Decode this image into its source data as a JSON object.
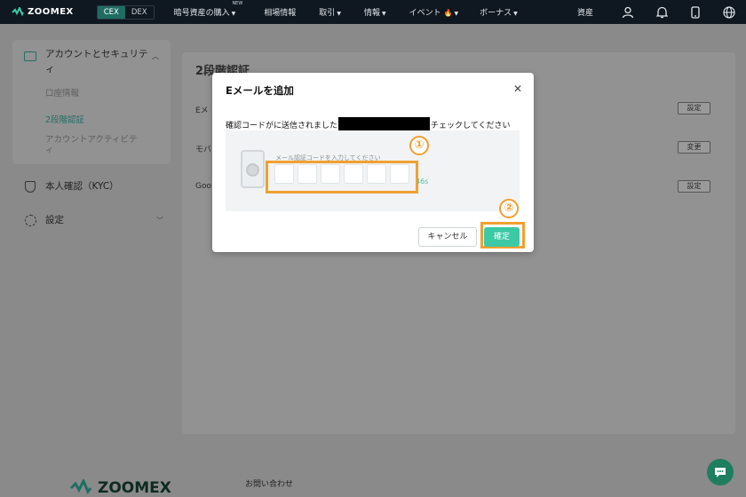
{
  "nav": {
    "logo_text": "ZOOMEX",
    "cex": "CEX",
    "dex": "DEX",
    "items": [
      {
        "label": "暗号資産の購入",
        "tag": "NEW"
      },
      {
        "label": "相場情報"
      },
      {
        "label": "取引"
      },
      {
        "label": "情報"
      },
      {
        "label": "イベント"
      },
      {
        "label": "ボーナス"
      }
    ],
    "assets": "資産",
    "icons": [
      "user-icon",
      "bell-icon",
      "phone-icon",
      "globe-icon"
    ]
  },
  "sidebar": {
    "account_security": "アカウントとセキュリティ",
    "account_info": "口座情報",
    "two_factor": "2段階認証",
    "account_activity": "アカウントアクティビティ",
    "kyc": "本人確認（KYC）",
    "settings": "設定"
  },
  "content": {
    "title": "2段階認証",
    "rows": [
      {
        "label": "Eメ",
        "button": "設定"
      },
      {
        "label": "モバ",
        "button": "変更"
      },
      {
        "label": "Goo",
        "button": "設定"
      }
    ]
  },
  "modal": {
    "title": "Eメールを追加",
    "sent_prefix": "確認コードがに送信されました",
    "sent_suffix": "チェックしてください",
    "code_hint": "メール認証コードを入力してください",
    "timer": "46s",
    "cancel": "キャンセル",
    "confirm": "確定"
  },
  "annotations": {
    "marker1": "①",
    "marker2": "②",
    "color": "#f0a030"
  },
  "footer": {
    "logo_text": "ZOOMEX",
    "contact": "お問い合わせ"
  },
  "colors": {
    "accent": "#3cc9a5",
    "nav_bg": "#0f1720",
    "overlay_bg": "#8a8a8a"
  }
}
